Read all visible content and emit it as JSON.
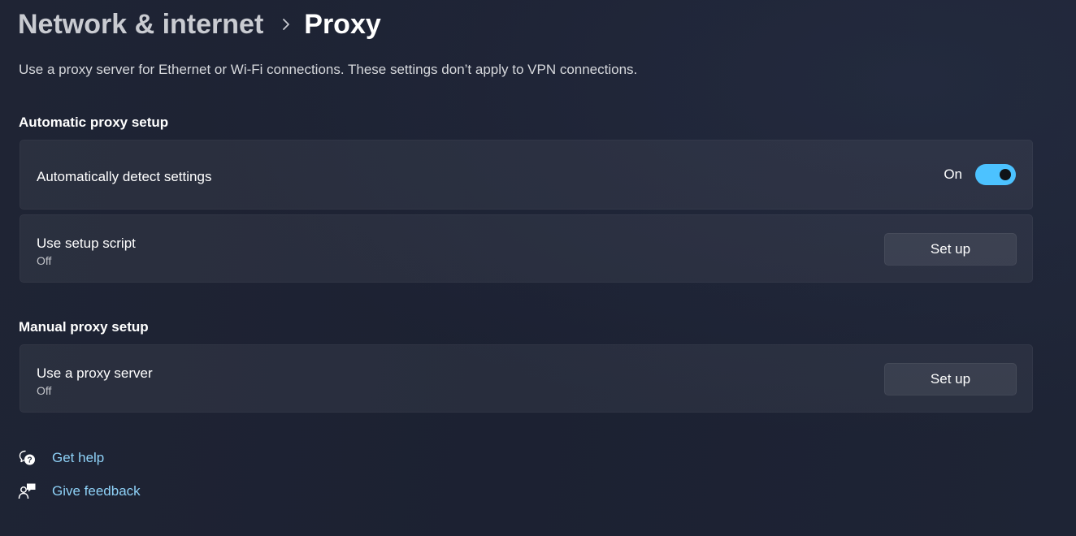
{
  "breadcrumb": {
    "parent": "Network & internet",
    "separator_icon": "chevron-right-icon",
    "current": "Proxy"
  },
  "description": "Use a proxy server for Ethernet or Wi-Fi connections. These settings don’t apply to VPN connections.",
  "automatic": {
    "header": "Automatic proxy setup",
    "detect": {
      "label": "Automatically detect settings",
      "toggle_state": "On",
      "toggle_on": true
    },
    "script": {
      "label": "Use setup script",
      "status": "Off",
      "button": "Set up"
    }
  },
  "manual": {
    "header": "Manual proxy setup",
    "proxy_server": {
      "label": "Use a proxy server",
      "status": "Off",
      "button": "Set up"
    }
  },
  "links": {
    "help": {
      "label": "Get help",
      "icon": "help-chat-icon"
    },
    "feedback": {
      "label": "Give feedback",
      "icon": "feedback-icon"
    }
  },
  "colors": {
    "accent": "#4cc2ff",
    "link": "#8ed1f7",
    "background": "#1d2333"
  }
}
